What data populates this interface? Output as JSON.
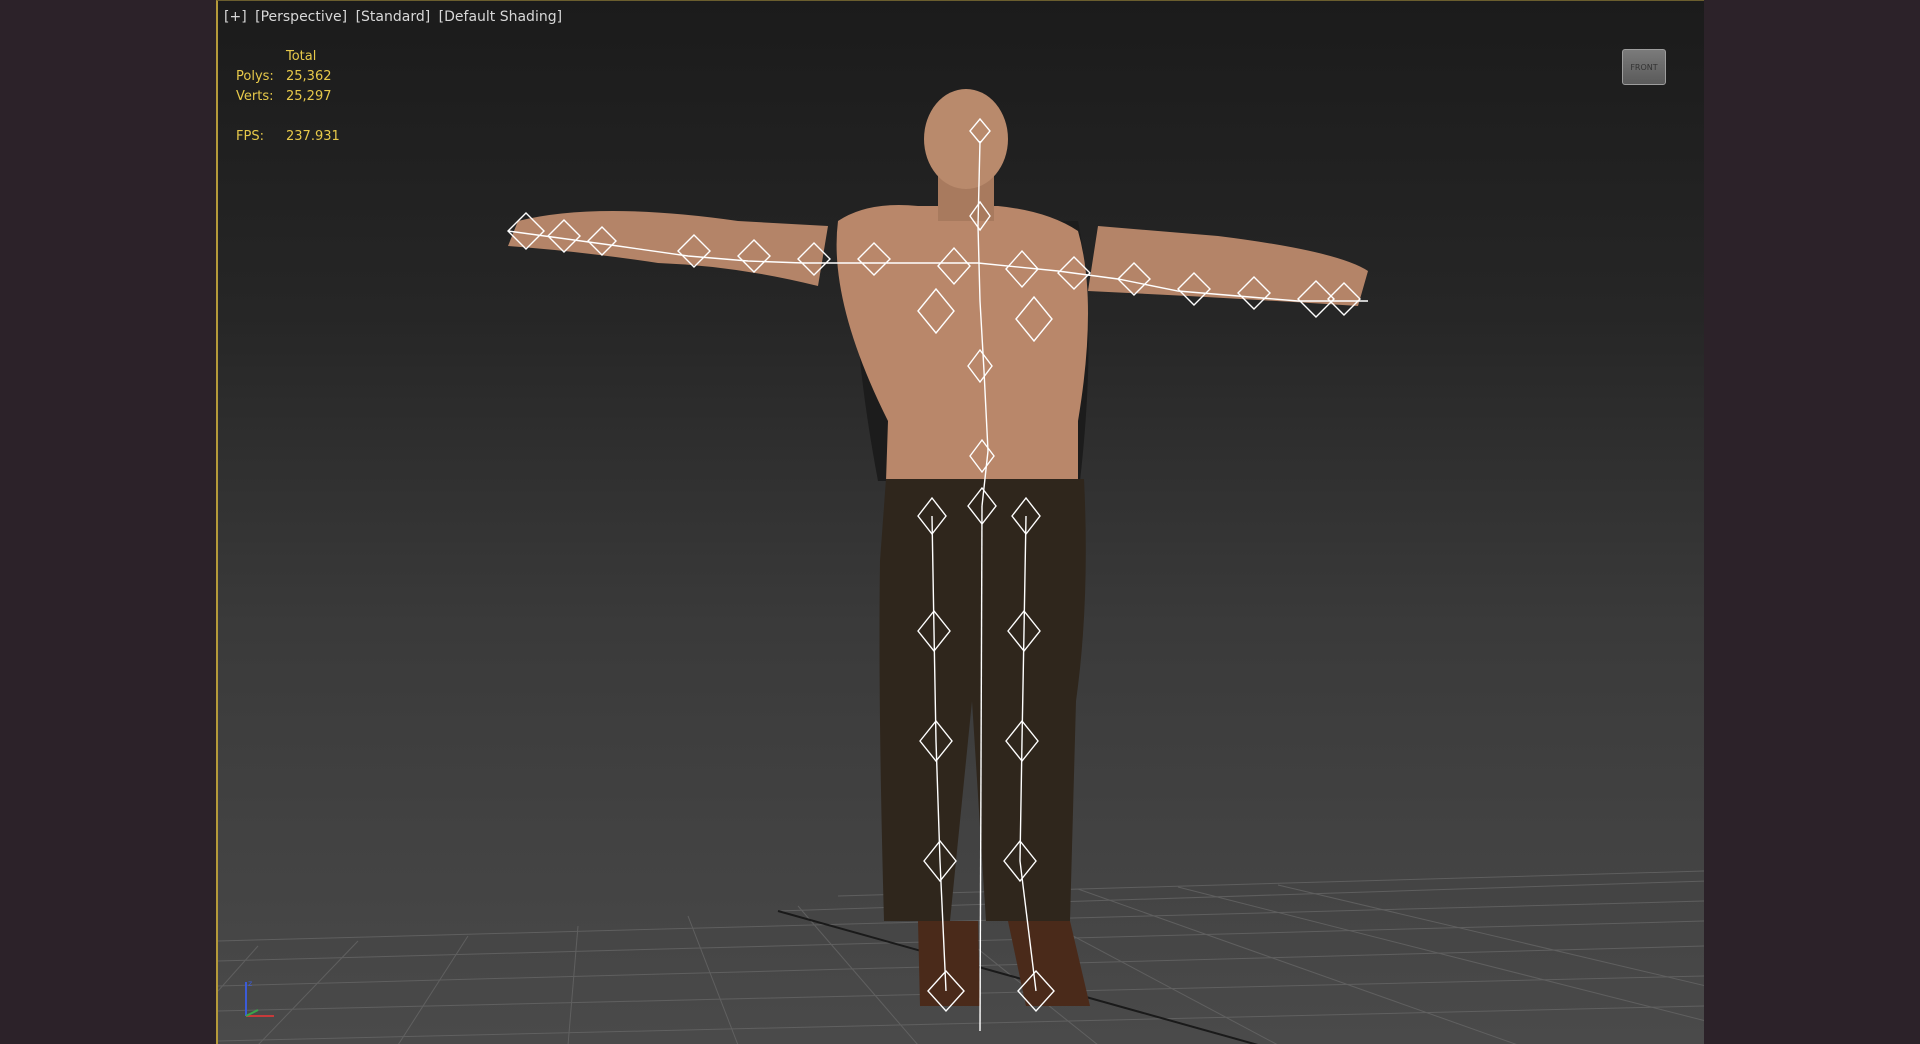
{
  "viewport": {
    "labels": [
      "[+]",
      "[Perspective]",
      "[Standard]",
      "[Default Shading]"
    ],
    "stats": {
      "header": "Total",
      "polys_label": "Polys:",
      "polys_value": "25,362",
      "verts_label": "Verts:",
      "verts_value": "25,297",
      "fps_label": "FPS:",
      "fps_value": "237.931"
    },
    "viewcube_label": "FRONT"
  },
  "colors": {
    "stats_text": "#e7c94a",
    "viewport_border": "#b59a3a",
    "sidebar_bg": "#2c2229",
    "skin": "#b9876a",
    "pants": "#2f261c",
    "bones": "#ffffff"
  },
  "icons": {
    "axis": "axis-gizmo-icon",
    "viewcube": "viewcube-icon"
  }
}
